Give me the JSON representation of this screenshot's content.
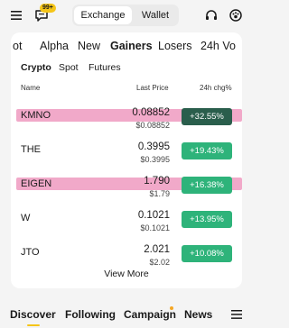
{
  "header": {
    "badge": "99+",
    "segments": [
      "Exchange",
      "Wallet"
    ],
    "icons": [
      "menu-icon",
      "chat-icon",
      "headset-icon",
      "paw-icon"
    ]
  },
  "categories": [
    "ot",
    "Alpha",
    "New",
    "Gainers",
    "Losers",
    "24h Vo"
  ],
  "active_category": "Gainers",
  "subtabs": [
    "Crypto",
    "Spot",
    "Futures"
  ],
  "active_subtab": "Crypto",
  "columns": {
    "name": "Name",
    "price": "Last Price",
    "change": "24h chg%"
  },
  "rows": [
    {
      "symbol": "KMNO",
      "price": "0.08852",
      "sub_price": "$0.08852",
      "change": "+32.55%",
      "highlighted": true
    },
    {
      "symbol": "THE",
      "price": "0.3995",
      "sub_price": "$0.3995",
      "change": "+19.43%",
      "highlighted": false
    },
    {
      "symbol": "EIGEN",
      "price": "1.790",
      "sub_price": "$1.79",
      "change": "+16.38%",
      "highlighted": true
    },
    {
      "symbol": "W",
      "price": "0.1021",
      "sub_price": "$0.1021",
      "change": "+13.95%",
      "highlighted": false
    },
    {
      "symbol": "JTO",
      "price": "2.021",
      "sub_price": "$2.02",
      "change": "+10.08%",
      "highlighted": false
    }
  ],
  "view_more": "View More",
  "bottom_nav": [
    "Discover",
    "Following",
    "Campaign",
    "News"
  ],
  "colors": {
    "gain": "#2eb37a",
    "gain_dark": "#2a5e4c",
    "highlight": "#f1a9c9",
    "brand": "#f5c518"
  }
}
